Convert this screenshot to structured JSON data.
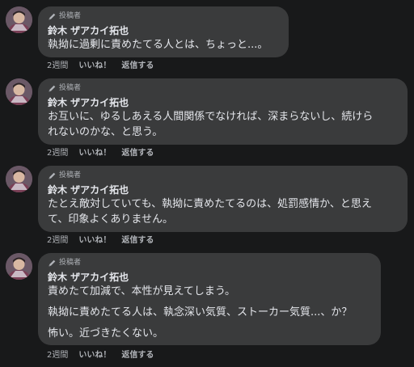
{
  "labels": {
    "badge": "投稿者",
    "like": "いいね！",
    "reply": "返信する"
  },
  "icons": {
    "badge": "pen-icon",
    "avatar": "profile-photo"
  },
  "colors": {
    "background": "#18191a",
    "bubble": "#3a3b3c",
    "text": "#e4e6eb",
    "muted": "#b0b3b8"
  },
  "comments": [
    {
      "author": "鈴木 ザアカイ拓也",
      "lines": [
        "執拗に過剰に責めたてる人とは、ちょっと...。"
      ],
      "time": "2週間"
    },
    {
      "author": "鈴木 ザアカイ拓也",
      "lines": [
        "お互いに、ゆるしあえる人間関係でなければ、深まらないし、続けら",
        "れないのかな、と思う。"
      ],
      "time": "2週間"
    },
    {
      "author": "鈴木 ザアカイ拓也",
      "lines": [
        "たとえ敵対していても、執拗に責めたてるのは、処罰感情か、と思え",
        "て、印象よくありません。"
      ],
      "time": "2週間"
    },
    {
      "author": "鈴木 ザアカイ拓也",
      "lines": [
        "責めたて加減で、本性が見えてしまう。",
        "執拗に責めたてる人は、執念深い気質、ストーカー気質...、か？",
        "怖い。近づきたくない。"
      ],
      "time": "2週間"
    }
  ]
}
